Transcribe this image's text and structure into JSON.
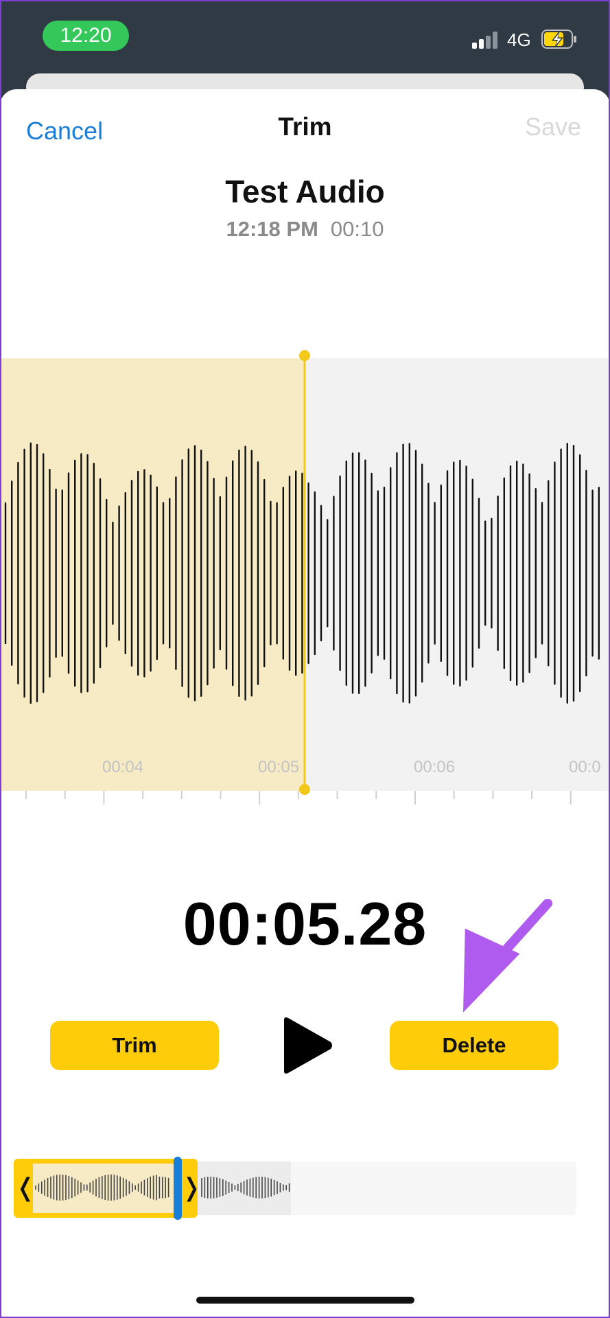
{
  "status_bar": {
    "time": "12:20",
    "network": "4G",
    "time_pill_color": "#34c759",
    "battery_icon": "battery-charging-icon",
    "signal_icon": "cellular-signal-icon"
  },
  "nav": {
    "cancel_label": "Cancel",
    "title": "Trim",
    "save_label": "Save"
  },
  "recording": {
    "title": "Test Audio",
    "date": "12:18 PM",
    "duration": "00:10"
  },
  "waveform": {
    "time_labels": [
      "00:04",
      "00:05",
      "00:06",
      "00:0"
    ],
    "selected_color": "#f6ebc5",
    "unselected_color": "#f2f2f2",
    "playhead_color": "#f2c81b"
  },
  "playback": {
    "current_time": "00:05.28"
  },
  "controls": {
    "trim_label": "Trim",
    "delete_label": "Delete",
    "play_icon": "play-icon",
    "accent_color": "#fecc09"
  },
  "annotation": {
    "arrow_icon": "pointer-arrow-icon",
    "arrow_color": "#b05bf0"
  },
  "scrubber": {
    "left_handle": "❬",
    "right_handle": "❭",
    "playhead_color": "#1a7fd8"
  }
}
